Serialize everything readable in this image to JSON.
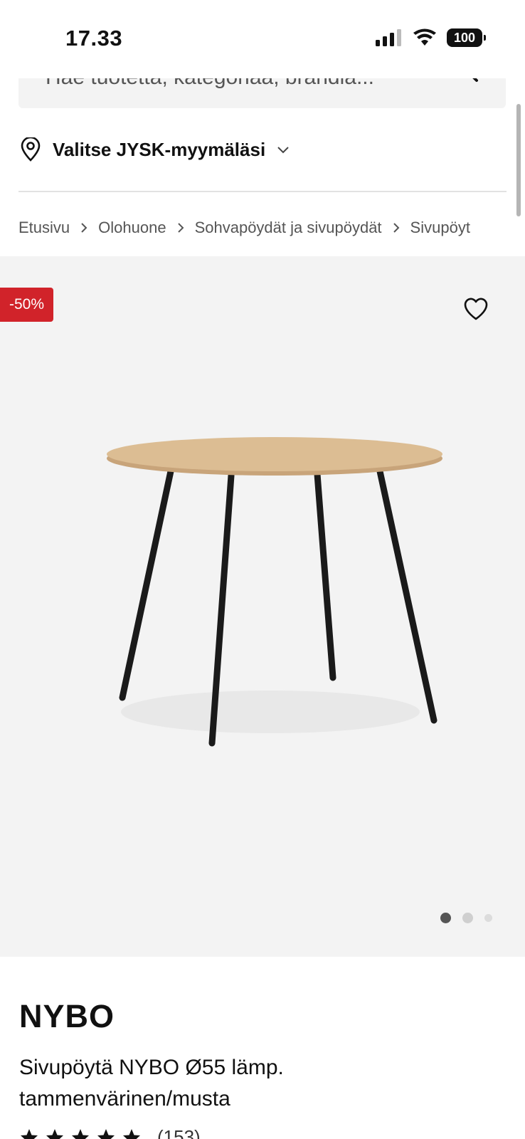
{
  "status_bar": {
    "time": "17.33",
    "battery": "100"
  },
  "search": {
    "placeholder": "Hae tuotetta, kategoriaa, brändiä..."
  },
  "store": {
    "label": "Valitse JYSK-myymäläsi"
  },
  "breadcrumb": [
    "Etusivu",
    "Olohuone",
    "Sohvapöydät ja sivupöydät",
    "Sivupöyt"
  ],
  "product": {
    "badge": "-50%",
    "title": "NYBO",
    "description_line1": "Sivupöytä NYBO Ø55 lämp.",
    "description_line2": "tammenvärinen/musta",
    "rating_count": "(153)",
    "image_dots": 3,
    "active_dot": 0
  },
  "colors": {
    "badge": "#d1232a",
    "image_bg": "#f3f3f3",
    "table_top": "#d9b98f",
    "legs": "#1a1a1a"
  }
}
